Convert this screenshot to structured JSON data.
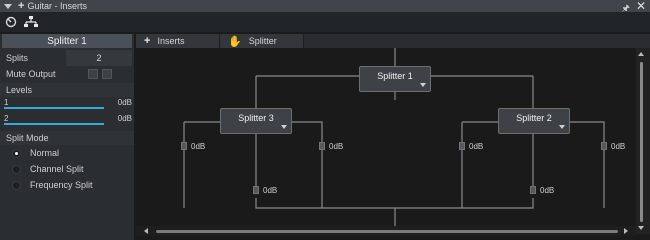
{
  "window": {
    "title": "Guitar - Inserts"
  },
  "toolbar": {
    "icons": [
      "routing-icon",
      "network-icon"
    ]
  },
  "left_panel": {
    "header": "Splitter 1",
    "splits_label": "Splits",
    "splits_value": "2",
    "mute_label": "Mute Output",
    "levels_label": "Levels",
    "levels": [
      {
        "num": "1",
        "db": "0dB"
      },
      {
        "num": "2",
        "db": "0dB"
      }
    ],
    "split_mode_label": "Split Mode",
    "modes": [
      "Normal",
      "Channel Split",
      "Frequency Split"
    ],
    "selected_mode": "Normal"
  },
  "tabs": [
    {
      "label": "Inserts",
      "icon": "plus-icon"
    },
    {
      "label": "Splitter",
      "icon": "hand-icon"
    }
  ],
  "graph": {
    "nodes": {
      "top": "Splitter 1",
      "left": "Splitter 3",
      "right": "Splitter 2"
    },
    "gain_labels": {
      "left_outer": "0dB",
      "left_inner": "0dB",
      "right_inner": "0dB",
      "right_outer": "0dB",
      "left_bottom": "0dB",
      "right_bottom": "0dB"
    }
  },
  "colors": {
    "level_bar": "#3aa6e0",
    "panel_header": "#4a5057",
    "wire": "#8a8a8a"
  }
}
